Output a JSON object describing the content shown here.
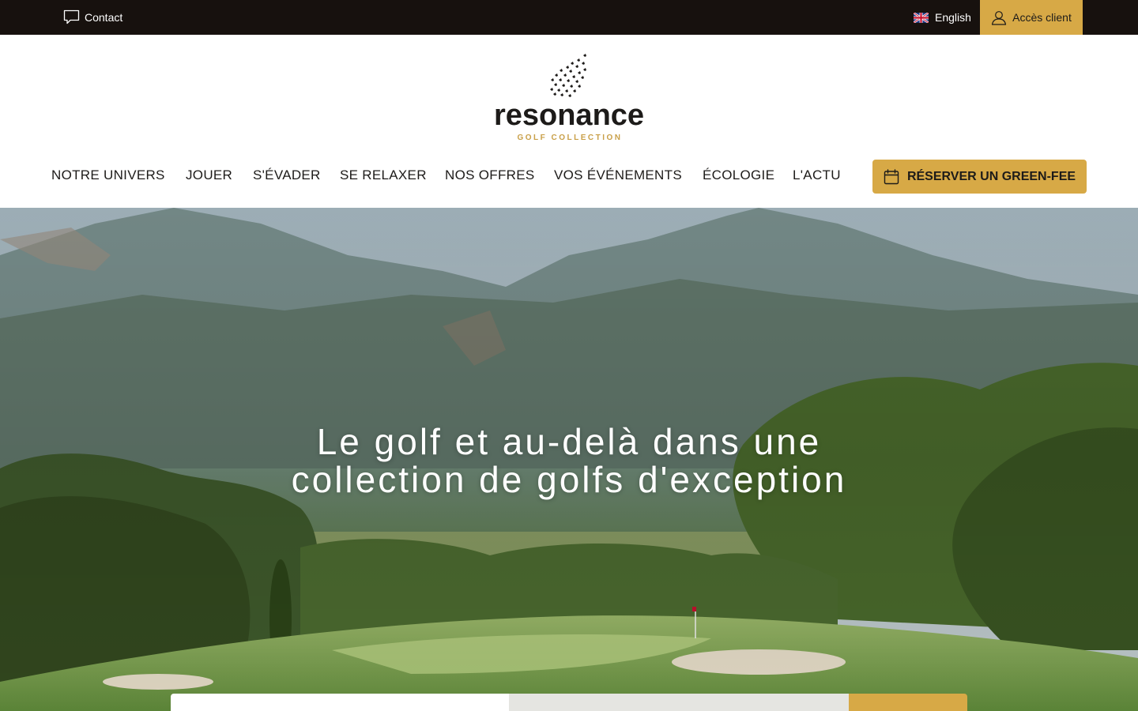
{
  "topbar": {
    "contact_label": "Contact",
    "language_label": "English",
    "client_label": "Accès client"
  },
  "brand": {
    "name": "resonance",
    "tagline": "GOLF COLLECTION"
  },
  "nav": {
    "items": [
      {
        "label": "NOTRE UNIVERS"
      },
      {
        "label": "JOUER"
      },
      {
        "label": "S'ÉVADER"
      },
      {
        "label": "SE RELAXER"
      },
      {
        "label": "NOS OFFRES"
      },
      {
        "label": "VOS ÉVÉNEMENTS"
      },
      {
        "label": "ÉCOLOGIE"
      },
      {
        "label": "L'ACTU"
      }
    ],
    "cta_label": "RÉSERVER UN GREEN-FEE"
  },
  "hero": {
    "title_line1": "Le golf et au-delà dans une",
    "title_line2": "collection de golfs d'exception"
  },
  "colors": {
    "topbar_bg": "#17110e",
    "accent_gold": "#d7a946",
    "text_dark": "#1d1b19",
    "search_mid": "#e5e5e1"
  },
  "icons": {
    "contact": "chat-bubble-icon",
    "language": "uk-flag-icon",
    "client": "user-icon",
    "booking": "calendar-icon",
    "brand": "bird-flock-icon"
  }
}
